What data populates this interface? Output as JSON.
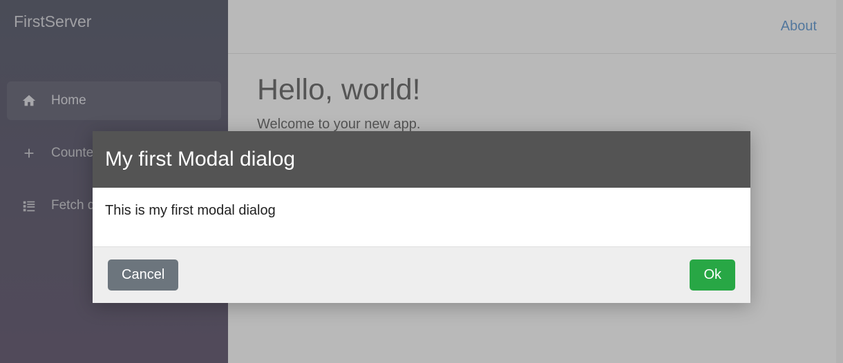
{
  "brand": "FirstServer",
  "sidebar": {
    "items": [
      {
        "label": "Home"
      },
      {
        "label": "Counter"
      },
      {
        "label": "Fetch data"
      }
    ]
  },
  "topbar": {
    "about_label": "About"
  },
  "page": {
    "heading": "Hello, world!",
    "subtext": "Welcome to your new app."
  },
  "modal": {
    "title": "My first Modal dialog",
    "body": "This is my first modal dialog",
    "cancel_label": "Cancel",
    "ok_label": "Ok"
  }
}
